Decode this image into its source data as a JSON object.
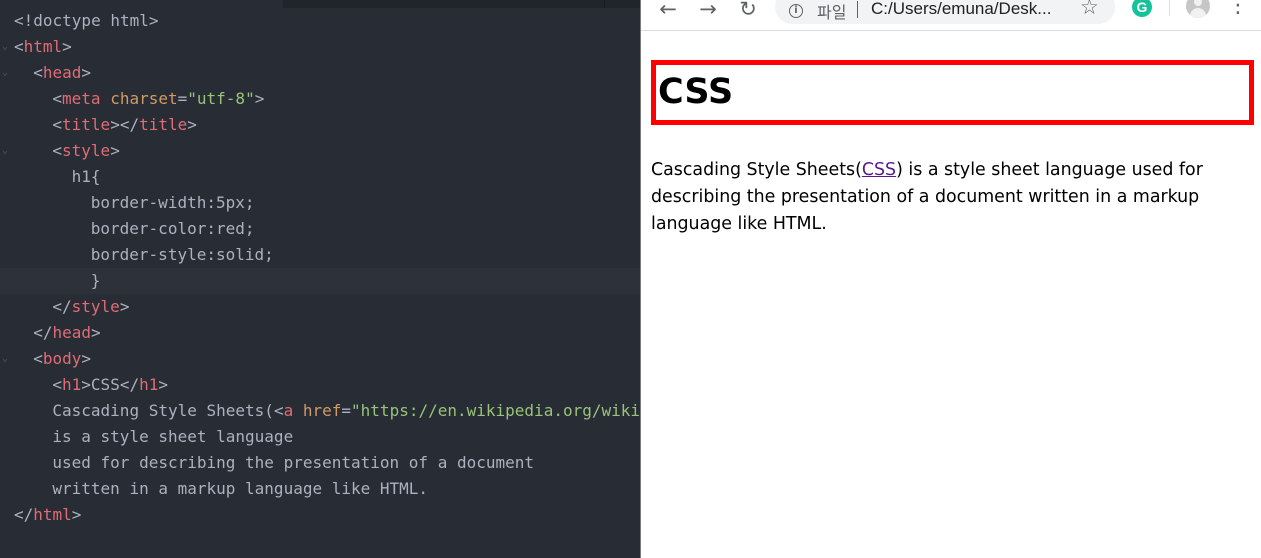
{
  "editor": {
    "lines": [
      {
        "id": "l1"
      },
      {
        "id": "l2"
      }
    ],
    "code": {
      "doctype": "<!doctype html>",
      "html_open": "html",
      "head_open": "head",
      "meta_tag": "meta",
      "charset_attr": "charset",
      "charset_val": "\"utf-8\"",
      "title_tag": "title",
      "style_tag": "style",
      "selector": "h1{",
      "decl1": "border-width:5px;",
      "decl2": "border-color:red;",
      "decl3": "border-style:solid;",
      "close_brace": "}",
      "body_tag": "body",
      "h1_tag": "h1",
      "h1_text": "CSS",
      "p_text_1": "Cascading Style Sheets(",
      "a_tag": "a",
      "href_attr": "href",
      "href_val": "\"https://en.wikipedia.org/wiki",
      "p_line_2": "is a style sheet language",
      "p_line_3": "used for describing the presentation of a document",
      "p_line_4": "written in a markup language like HTML."
    }
  },
  "browser": {
    "back_icon": "arrow-back",
    "forward_icon": "arrow-forward",
    "reload_icon": "reload",
    "address": {
      "scheme_label": "파일",
      "url": "C:/Users/emuna/Desk..."
    },
    "page": {
      "heading": "CSS",
      "para_before": "Cascading Style Sheets(",
      "link_text": "CSS",
      "para_after": ") is a style sheet language used for describing the presentation of a document written in a markup language like HTML."
    }
  },
  "colors": {
    "editor_bg": "#282c34",
    "tag": "#e06c75",
    "attr": "#d19a66",
    "string": "#98c379",
    "plain": "#abb2bf",
    "heading_border": "#ff0000",
    "link_visited": "#551a8b"
  }
}
